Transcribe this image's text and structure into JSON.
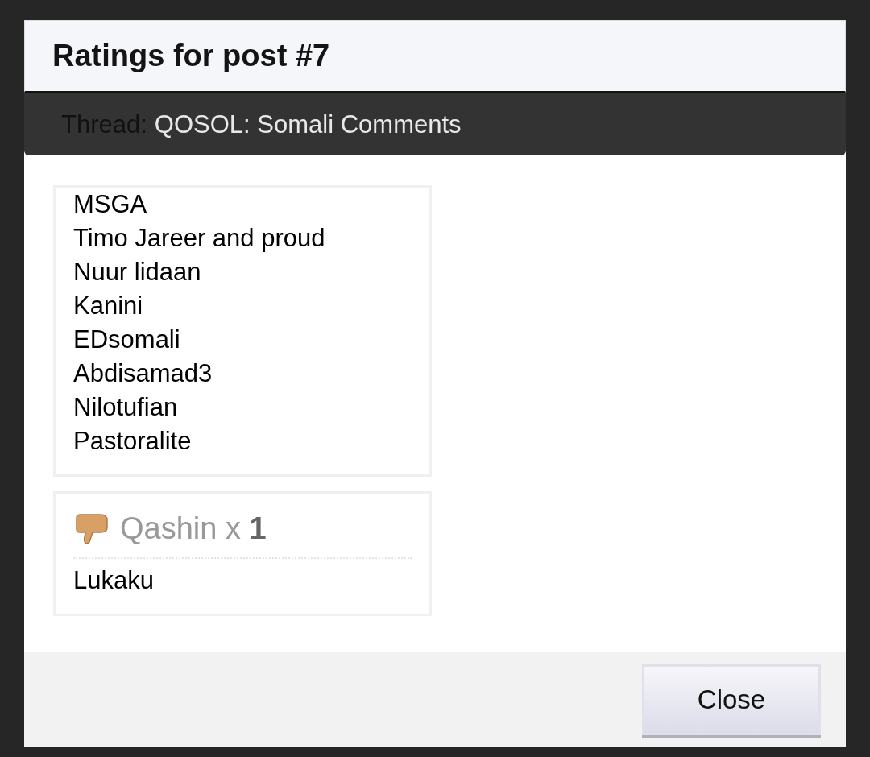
{
  "dialog": {
    "title": "Ratings for post #7",
    "thread_label": "Thread:",
    "thread_name": "QOSOL: Somali Comments",
    "groups": [
      {
        "kind": "plain",
        "users": [
          "MSGA",
          "Timo Jareer and proud",
          "Nuur lidaan",
          "Kanini",
          "EDsomali",
          "Abdisamad3",
          "Nilotufian",
          "Pastoralite"
        ]
      },
      {
        "kind": "rated",
        "heading": "Qashin x **1**",
        "users": [
          "Lukaku"
        ]
      }
    ],
    "buttons": [
      "Close"
    ]
  }
}
